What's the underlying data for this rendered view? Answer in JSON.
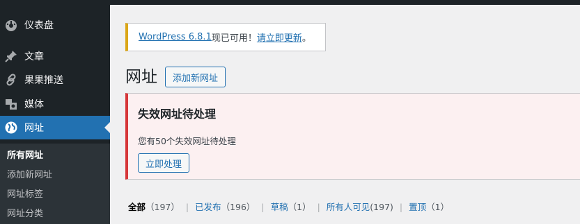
{
  "sidebar": {
    "items": [
      {
        "label": "仪表盘",
        "icon": "dashboard-icon"
      },
      {
        "label": "文章",
        "icon": "pushpin-icon"
      },
      {
        "label": "果果推送",
        "icon": "link-icon"
      },
      {
        "label": "媒体",
        "icon": "media-icon"
      },
      {
        "label": "网址",
        "icon": "globe-icon"
      }
    ],
    "submenu": [
      "所有网址",
      "添加新网址",
      "网址标签",
      "网址分类"
    ]
  },
  "update_notice": {
    "version_link": "WordPress 6.8.1",
    "text": " 现已可用！",
    "update_link": "请立即更新",
    "end": "。"
  },
  "page": {
    "title": "网址",
    "add_new_label": "添加新网址"
  },
  "error_notice": {
    "heading": "失效网址待处理",
    "message": "您有50个失效网址待处理",
    "button_label": "立即处理"
  },
  "filters": [
    {
      "label": "全部",
      "count": "（197）"
    },
    {
      "label": "已发布",
      "count": "（196）"
    },
    {
      "label": "草稿",
      "count": "（1）"
    },
    {
      "label": "所有人可见",
      "count": "(197)"
    },
    {
      "label": "置顶",
      "count": "（1）"
    }
  ],
  "colors": {
    "sidebar_bg": "#1d2327",
    "accent": "#2271b1",
    "warning": "#dba617",
    "error": "#d63638"
  }
}
